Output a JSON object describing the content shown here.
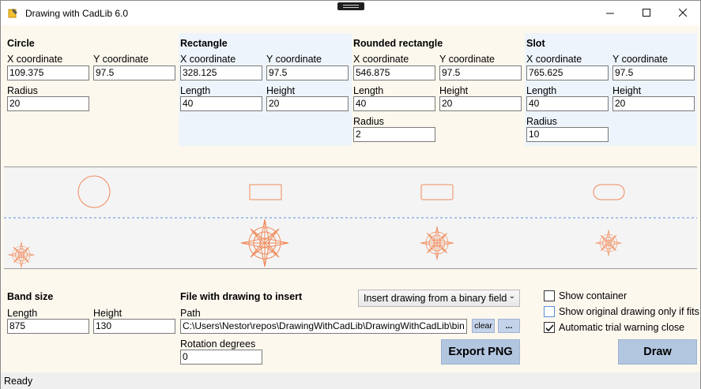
{
  "window": {
    "title": "Drawing with CadLib 6.0"
  },
  "circle": {
    "title": "Circle",
    "x_label": "X coordinate",
    "y_label": "Y coordinate",
    "x": "109.375",
    "y": "97.5",
    "radius_label": "Radius",
    "radius": "20"
  },
  "rectangle": {
    "title": "Rectangle",
    "x_label": "X coordinate",
    "y_label": "Y coordinate",
    "x": "328.125",
    "y": "97.5",
    "length_label": "Length",
    "height_label": "Height",
    "length": "40",
    "height": "20"
  },
  "rounded": {
    "title": "Rounded rectangle",
    "x_label": "X coordinate",
    "y_label": "Y coordinate",
    "x": "546.875",
    "y": "97.5",
    "length_label": "Length",
    "height_label": "Height",
    "length": "40",
    "height": "20",
    "radius_label": "Radius",
    "radius": "2"
  },
  "slot": {
    "title": "Slot",
    "x_label": "X coordinate",
    "y_label": "Y coordinate",
    "x": "765.625",
    "y": "97.5",
    "length_label": "Length",
    "height_label": "Height",
    "length": "40",
    "height": "20",
    "radius_label": "Radius",
    "radius": "10"
  },
  "band": {
    "title": "Band size",
    "length_label": "Length",
    "height_label": "Height",
    "length": "875",
    "height": "130"
  },
  "file": {
    "title": "File with drawing to insert",
    "path_label": "Path",
    "path": "C:\\Users\\Nestor\\repos\\DrawingWithCadLib\\DrawingWithCadLib\\bin",
    "rotation_label": "Rotation degrees",
    "rotation": "0",
    "clear_label": "clear",
    "browse_label": "...",
    "mode": "Insert drawing from a binary field"
  },
  "options": {
    "show_container": "Show container",
    "show_original": "Show original drawing only if fits",
    "auto_close": "Automatic trial warning close"
  },
  "buttons": {
    "export": "Export PNG",
    "draw": "Draw"
  },
  "status": {
    "text": "Ready"
  },
  "colors": {
    "shape": "#f08a5a",
    "guide": "#5b8fdc",
    "accent_button": "#b3c6e0"
  }
}
